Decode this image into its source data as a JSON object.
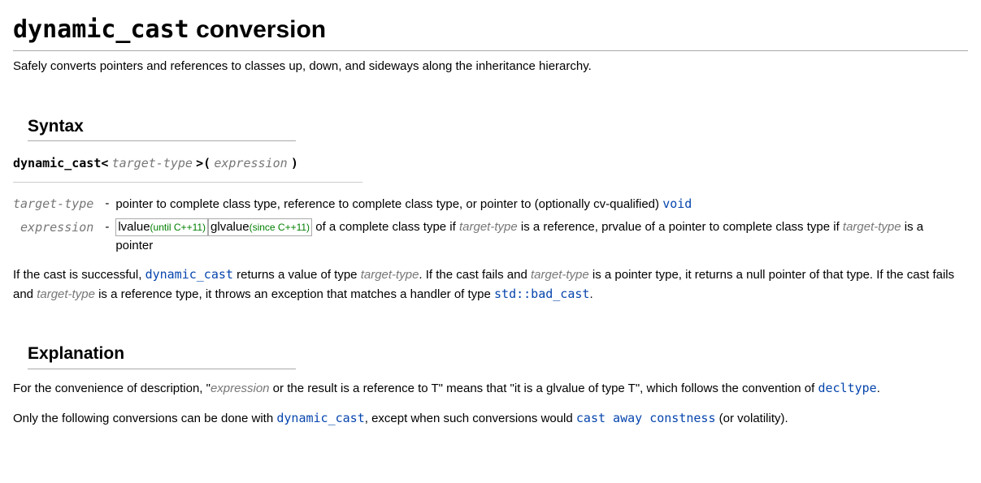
{
  "title": {
    "code": "dynamic_cast",
    "rest": " conversion"
  },
  "intro": "Safely converts pointers and references to classes up, down, and sideways along the inheritance hierarchy.",
  "sections": {
    "syntax": {
      "heading": "Syntax",
      "syntax_line": {
        "kw1": "dynamic_cast<",
        "p1": "target-type",
        "kw2": ">(",
        "p2": "expression",
        "kw3": ")"
      },
      "params": [
        {
          "name": "target-type",
          "dash": "-",
          "desc_pre": "pointer to complete class type, reference to complete class type, or pointer to (optionally cv-qualified) ",
          "desc_link": "void",
          "desc_post": ""
        },
        {
          "name": "expression",
          "dash": "-",
          "rev1_text": "lvalue",
          "rev1_mark": "(until C++11)",
          "rev2_text": "glvalue",
          "rev2_mark": "(since C++11)",
          "desc_mid1": " of a complete class type if ",
          "desc_p1": "target-type",
          "desc_mid2": " is a reference, prvalue of a pointer to complete class type if ",
          "desc_p2": "target-type",
          "desc_mid3": " is a pointer"
        }
      ],
      "result_para": {
        "t1": "If the cast is successful, ",
        "l1": "dynamic_cast",
        "t2": " returns a value of type ",
        "p1": "target-type",
        "t3": ". If the cast fails and ",
        "p2": "target-type",
        "t4": " is a pointer type, it returns a null pointer of that type. If the cast fails and ",
        "p3": "target-type",
        "t5": " is a reference type, it throws an exception that matches a handler of type ",
        "l2": "std::bad_cast",
        "t6": "."
      }
    },
    "explanation": {
      "heading": "Explanation",
      "para1": {
        "t1": "For the convenience of description, \"",
        "p1": "expression",
        "t2": " or the result is a reference to T\" means that \"it is a glvalue of type T\", which follows the convention of ",
        "l1": "decltype",
        "t3": "."
      },
      "para2": {
        "t1": "Only the following conversions can be done with ",
        "l1": "dynamic_cast",
        "t2": ", except when such conversions would ",
        "l2": "cast away constness",
        "t3": " (or volatility)."
      }
    }
  }
}
